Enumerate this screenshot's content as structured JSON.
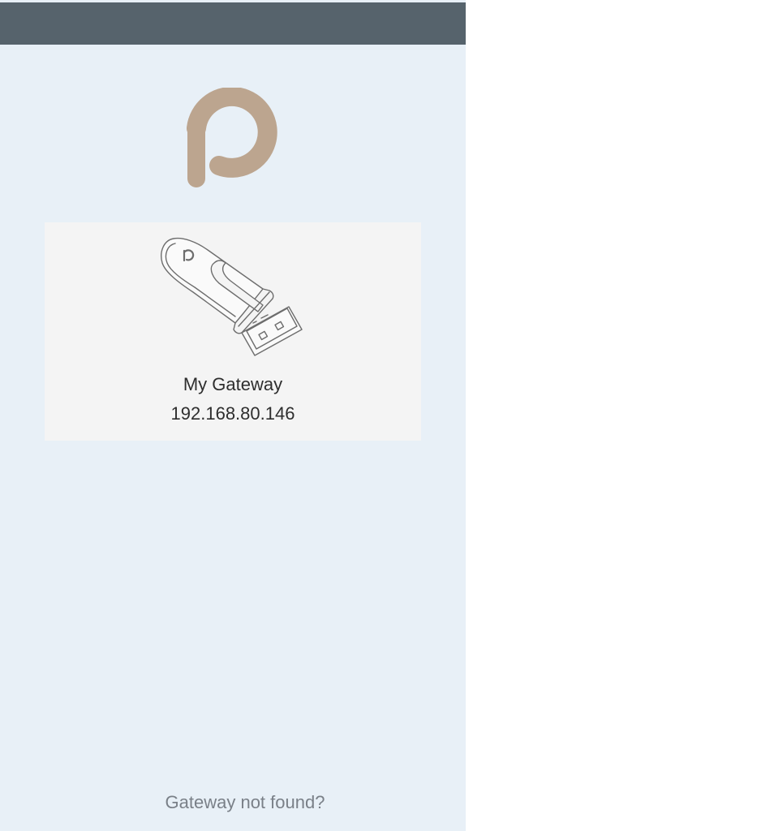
{
  "header": {
    "background_color": "#56636c"
  },
  "logo": {
    "icon": "brand-logo-icon",
    "color": "#bca58f"
  },
  "gateways": [
    {
      "icon": "usb-dongle-icon",
      "name": "My Gateway",
      "ip": "192.168.80.146"
    }
  ],
  "footer": {
    "not_found_label": "Gateway not found?"
  },
  "colors": {
    "panel_background": "#e8f0f7",
    "card_background": "#f4f4f4",
    "text_primary": "#2e2e2e",
    "text_muted": "#7a8088"
  }
}
